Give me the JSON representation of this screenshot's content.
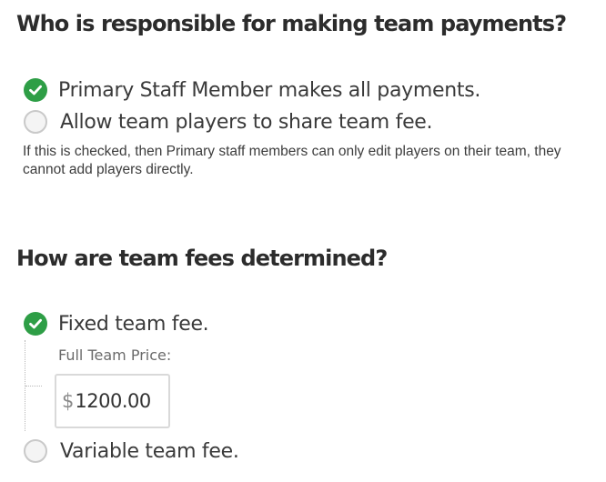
{
  "payments": {
    "heading": "Who is responsible for making team payments?",
    "options": [
      {
        "label": "Primary Staff Member makes all payments.",
        "checked": true
      },
      {
        "label": "Allow team players to share team fee.",
        "checked": false
      }
    ],
    "help_text": "If this is checked, then Primary staff members can only edit players on their team, they cannot add players directly."
  },
  "fees": {
    "heading": "How are team fees determined?",
    "options": [
      {
        "label": "Fixed team fee.",
        "checked": true
      },
      {
        "label": "Variable team fee.",
        "checked": false
      }
    ],
    "price_field": {
      "label": "Full Team Price:",
      "currency_symbol": "$",
      "value": "1200.00"
    }
  },
  "colors": {
    "checked": "#2e9e46",
    "unchecked_border": "#c9c9c9",
    "heading_text": "#2c2c2c",
    "body_text": "#3a3a3a"
  },
  "icons": {
    "checked": "check-circle-icon",
    "unchecked": "empty-circle-icon"
  }
}
